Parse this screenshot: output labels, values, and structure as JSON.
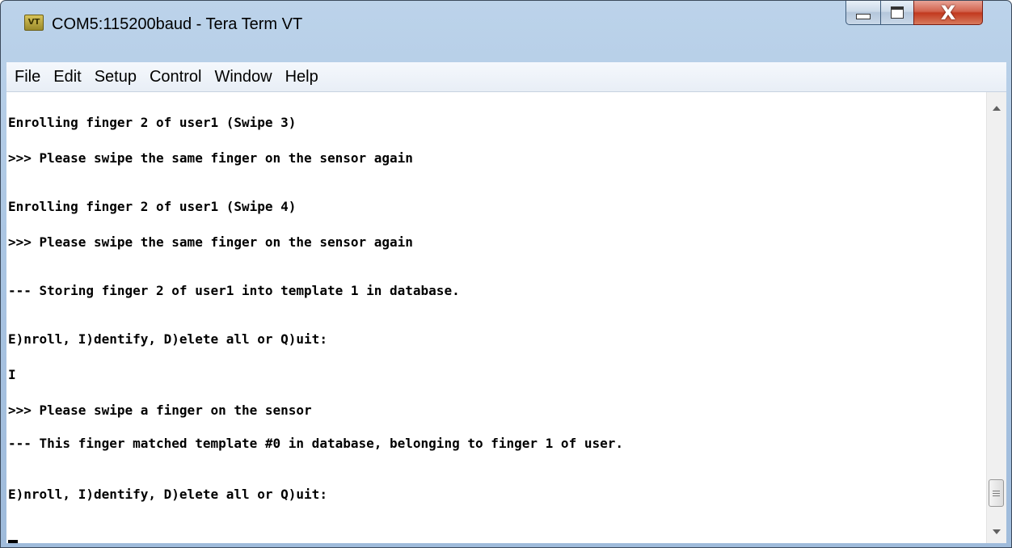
{
  "window": {
    "title": "COM5:115200baud - Tera Term VT",
    "icon": "tera-term-app-icon",
    "icon_text": "VT",
    "controls": {
      "minimize": "minimize-icon",
      "maximize": "maximize-icon",
      "close": "close-icon",
      "close_glyph": "X"
    }
  },
  "menu": [
    "File",
    "Edit",
    "Setup",
    "Control",
    "Window",
    "Help"
  ],
  "terminal": {
    "lines": [
      "Enrolling finger 2 of user1 (Swipe 3)",
      ">>> Please swipe the same finger on the sensor again",
      "Enrolling finger 2 of user1 (Swipe 4)",
      ">>> Please swipe the same finger on the sensor again",
      "--- Storing finger 2 of user1 into template 1 in database.",
      "E)nroll, I)dentify, D)elete all or Q)uit:",
      "I",
      ">>> Please swipe a finger on the sensor",
      "--- This finger matched template #0 in database, belonging to finger 1 of user.",
      "E)nroll, I)dentify, D)elete all or Q)uit:"
    ]
  },
  "colors": {
    "terminal_bg": "#ffffff",
    "terminal_fg": "#000000",
    "close_button": "#c2391f",
    "title_bar": "#a9c4e2"
  }
}
